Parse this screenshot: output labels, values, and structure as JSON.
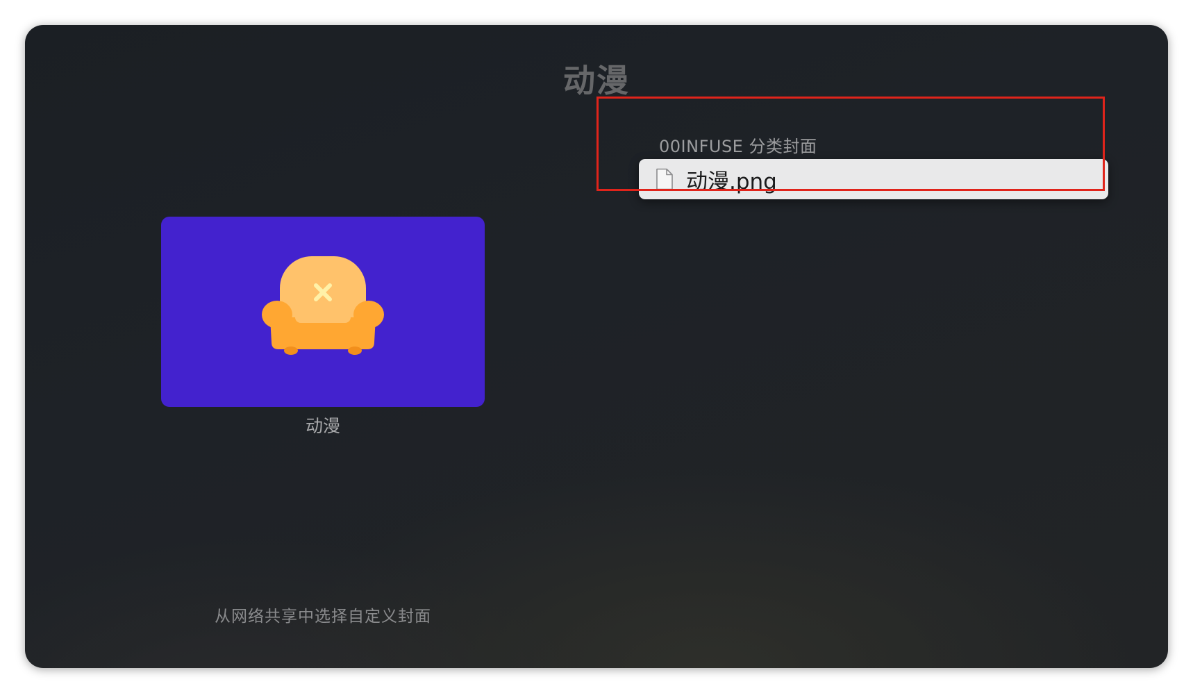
{
  "page": {
    "title": "动漫"
  },
  "cover": {
    "label": "动漫",
    "background_color": "#4322ce",
    "icon": "armchair-icon"
  },
  "picker": {
    "hint": "从网络共享中选择自定义封面"
  },
  "file_browser": {
    "folder_name": "00INFUSE 分类封面",
    "files": [
      {
        "name": "动漫.png",
        "icon": "document-icon",
        "focused": true
      }
    ]
  },
  "annotation": {
    "highlight_color": "#e0241b"
  }
}
